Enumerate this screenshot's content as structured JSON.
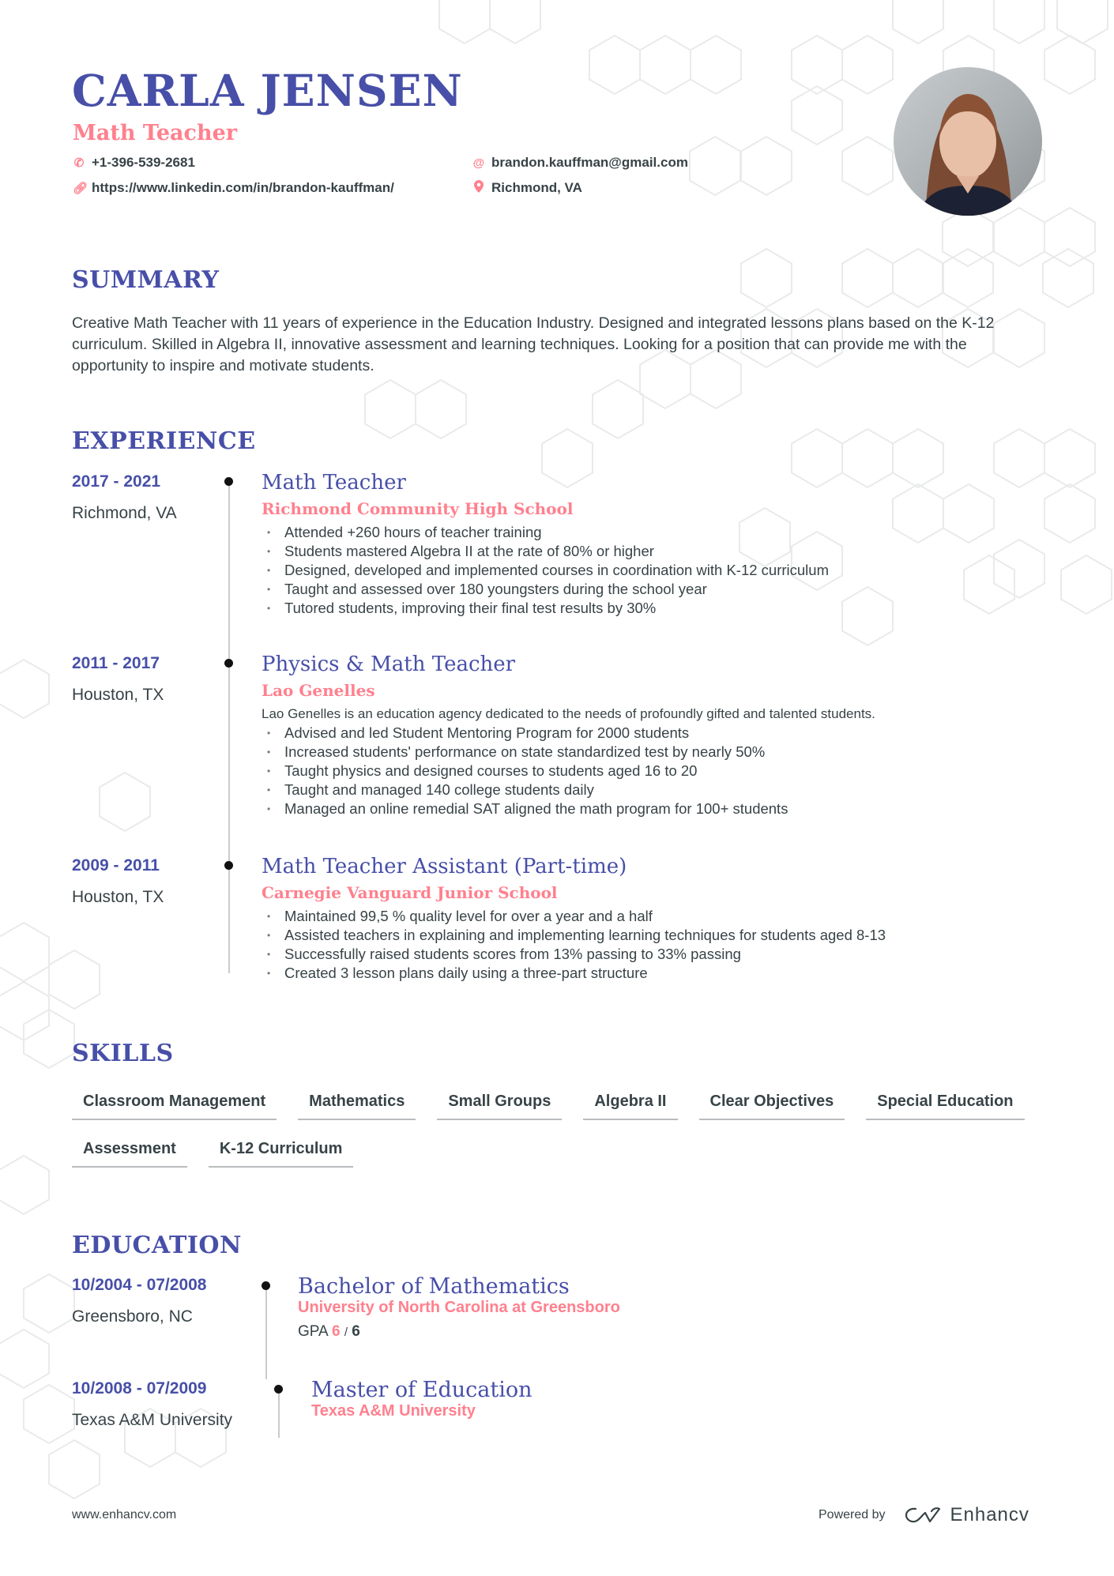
{
  "header": {
    "name": "CARLA JENSEN",
    "title": "Math Teacher",
    "contacts": {
      "phone": {
        "icon": "phone-icon",
        "value": "+1-396-539-2681"
      },
      "email": {
        "icon": "at-icon",
        "value": "brandon.kauffman@gmail.com"
      },
      "link": {
        "icon": "link-icon",
        "value": "https://www.linkedin.com/in/brandon-kauffman/"
      },
      "location": {
        "icon": "location-pin-icon",
        "value": "Richmond, VA"
      }
    },
    "photo_alt": "Profile photo"
  },
  "summary": {
    "title": "SUMMARY",
    "text": "Creative Math Teacher with 11 years of experience in the Education Industry. Designed and integrated lessons plans based on the K-12 curriculum. Skilled in Algebra II, innovative assessment and learning techniques. Looking for a position that can provide me with the opportunity to inspire and motivate students."
  },
  "experience": {
    "title": "EXPERIENCE",
    "items": [
      {
        "dates": "2017 - 2021",
        "location": "Richmond, VA",
        "role": "Math Teacher",
        "company": "Richmond Community High School",
        "description": "",
        "bullets": [
          "Attended +260 hours of teacher training",
          "Students mastered Algebra II at the rate of 80% or higher",
          "Designed, developed and implemented courses in coordination with K-12 curriculum",
          "Taught and assessed over 180 youngsters during the school year",
          "Tutored students, improving their final test results by 30%"
        ]
      },
      {
        "dates": "2011 - 2017",
        "location": "Houston, TX",
        "role": "Physics & Math Teacher",
        "company": "Lao Genelles",
        "description": "Lao Genelles is an education agency dedicated to the needs of profoundly gifted and talented students.",
        "bullets": [
          "Advised and led Student Mentoring Program for 2000 students",
          "Increased students' performance on state standardized test by nearly 50%",
          "Taught physics and designed courses to students aged 16 to 20",
          "Taught and managed 140 college students daily",
          "Managed an online remedial SAT aligned the math program for 100+ students"
        ]
      },
      {
        "dates": "2009 - 2011",
        "location": "Houston, TX",
        "role": "Math Teacher Assistant (Part-time)",
        "company": "Carnegie Vanguard Junior School",
        "description": "",
        "bullets": [
          "Maintained 99,5 % quality level for over a year and a half",
          "Assisted teachers in explaining and implementing learning techniques for students aged 8-13",
          "Successfully raised students scores from 13% passing to 33% passing",
          "Created 3 lesson plans daily using a three-part structure"
        ]
      }
    ]
  },
  "skills": {
    "title": "SKILLS",
    "items": [
      "Classroom Management",
      "Mathematics",
      "Small Groups",
      "Algebra II",
      "Clear Objectives",
      "Special Education",
      "Assessment",
      "K-12 Curriculum"
    ]
  },
  "education": {
    "title": "EDUCATION",
    "items": [
      {
        "dates": "10/2004 - 07/2008",
        "location": "Greensboro, NC",
        "degree": "Bachelor of Mathematics",
        "school": "University of North Carolina at Greensboro",
        "gpa_label": "GPA",
        "gpa_value": "6",
        "gpa_sep": "/",
        "gpa_max": "6"
      },
      {
        "dates": "10/2008 - 07/2009",
        "location": "Texas A&M University",
        "degree": "Master of Education",
        "school": "Texas A&M University"
      }
    ]
  },
  "footer": {
    "website": "www.enhancv.com",
    "powered_by": "Powered by",
    "brand": "Enhancv"
  },
  "colors": {
    "primary": "#474FA8",
    "accent": "#FF808E",
    "text": "#384347"
  }
}
